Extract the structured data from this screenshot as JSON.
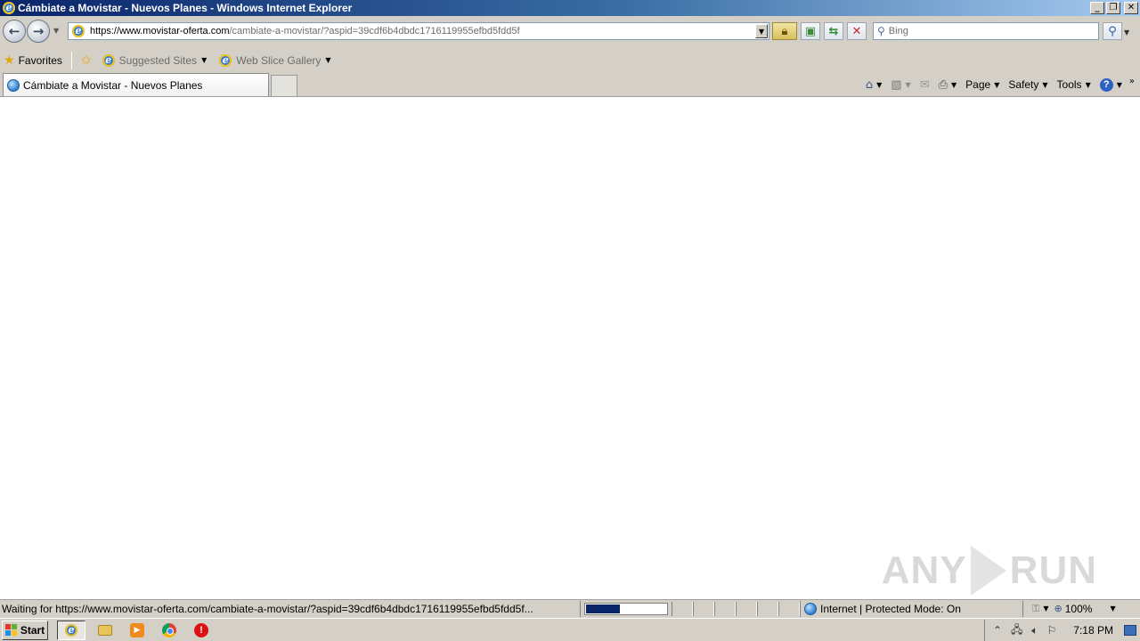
{
  "window": {
    "title": "Cámbiate a Movistar - Nuevos Planes - Windows Internet Explorer"
  },
  "address": {
    "url_scheme": "https://www.",
    "url_domain": "movistar-oferta.com",
    "url_path": "/cambiate-a-movistar/?aspid=39cdf6b4dbdc1716119955efbd5fdd5f"
  },
  "search": {
    "placeholder": "Bing"
  },
  "favorites": {
    "label": "Favorites",
    "suggested_sites": "Suggested Sites",
    "web_slice_gallery": "Web Slice Gallery"
  },
  "tab": {
    "title": "Cámbiate a Movistar - Nuevos Planes"
  },
  "command_bar": {
    "page": "Page",
    "safety": "Safety",
    "tools": "Tools"
  },
  "status": {
    "text": "Waiting for https://www.movistar-oferta.com/cambiate-a-movistar/?aspid=39cdf6b4dbdc1716119955efbd5fdd5f...",
    "progress_fraction": 0.42,
    "zone": "Internet | Protected Mode: On",
    "zoom": "100%"
  },
  "taskbar": {
    "start": "Start",
    "clock": "7:18 PM"
  },
  "watermark": {
    "left": "ANY",
    "right": "RUN"
  },
  "colors": {
    "titlebar": "#0a246a",
    "progress_fill": "#0a246a",
    "chrome": "#d4d0c8"
  }
}
